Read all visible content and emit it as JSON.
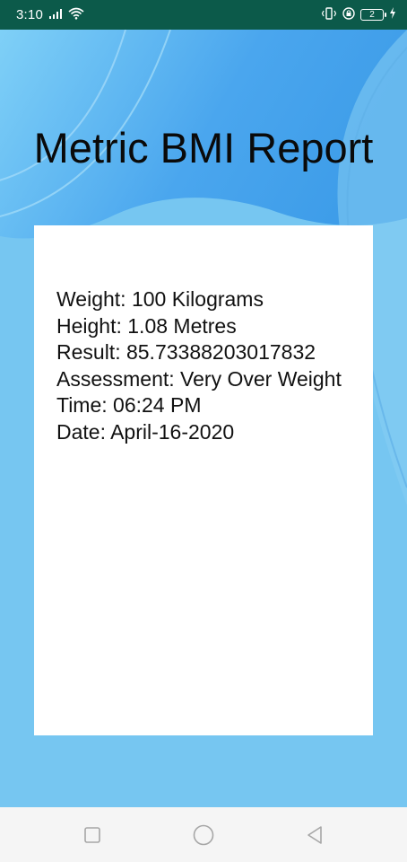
{
  "status_bar": {
    "time": "3:10",
    "battery_level": "2"
  },
  "report": {
    "title": "Metric BMI Report",
    "lines": [
      "Weight: 100 Kilograms",
      "Height: 1.08 Metres",
      "Result: 85.73388203017832",
      "Assessment: Very Over Weight",
      "Time: 06:24 PM",
      "Date: April-16-2020"
    ]
  },
  "colors": {
    "status_bar_bg": "#0c5a4a",
    "background": "#76c6f1",
    "card": "#ffffff",
    "text": "#0a0a0a",
    "nav_bar_bg": "#f5f5f5"
  },
  "icons": {
    "signal": "signal-icon",
    "wifi": "wifi-icon",
    "vibrate": "vibrate-icon",
    "lock": "lock-icon",
    "battery": "battery-icon",
    "charging": "charging-icon",
    "recent_apps": "recent-apps-icon",
    "home": "home-icon",
    "back": "back-icon"
  }
}
